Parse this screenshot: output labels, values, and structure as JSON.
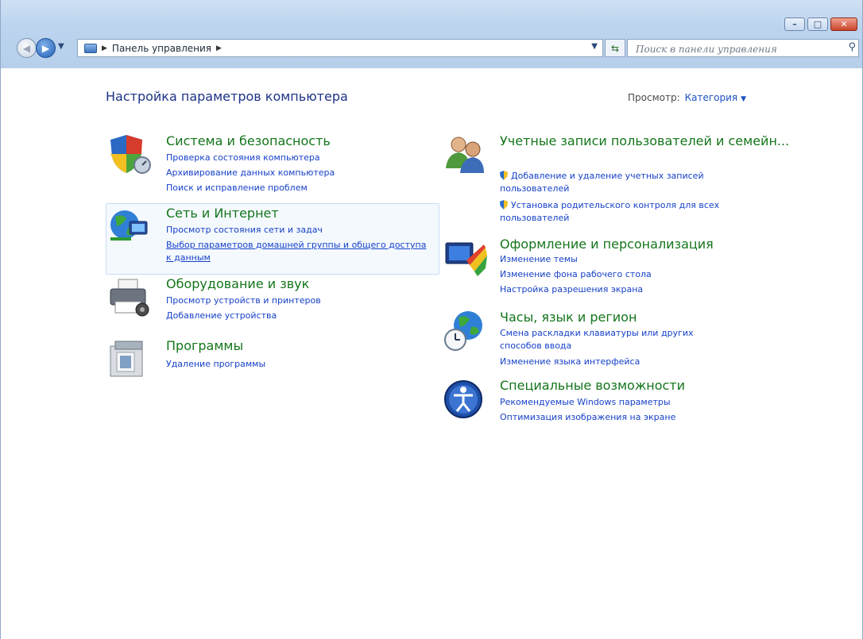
{
  "window": {
    "caption_buttons": {
      "minimize": "–",
      "maximize": "□",
      "close": "✕"
    }
  },
  "navbar": {
    "address_path": [
      "Панель управления"
    ],
    "search_placeholder": "Поиск в панели управления"
  },
  "page": {
    "title": "Настройка параметров компьютера",
    "view_label": "Просмотр:",
    "view_value": "Категория"
  },
  "categories": [
    {
      "title": "Система и безопасность",
      "icon": "shield-icon",
      "links": [
        "Проверка состояния компьютера",
        "Архивирование данных компьютера",
        "Поиск и исправление проблем"
      ]
    },
    {
      "title": "Сеть и Интернет",
      "icon": "network-globe-icon",
      "links": [
        "Просмотр состояния сети и задач",
        "Выбор параметров домашней группы и общего доступа к данным"
      ]
    },
    {
      "title": "Оборудование и звук",
      "icon": "printer-icon",
      "links": [
        "Просмотр устройств и принтеров",
        "Добавление устройства"
      ]
    },
    {
      "title": "Программы",
      "icon": "programs-icon",
      "links": [
        "Удаление программы"
      ]
    },
    {
      "title": "Учетные записи пользователей и семейн...",
      "icon": "users-icon",
      "links": [
        "Добавление и удаление учетных записей пользователей",
        "Установка родительского контроля для всех пользователей"
      ]
    },
    {
      "title": "Оформление и персонализация",
      "icon": "personalization-icon",
      "links": [
        "Изменение темы",
        "Изменение фона рабочего стола",
        "Настройка разрешения экрана"
      ]
    },
    {
      "title": "Часы, язык и регион",
      "icon": "clock-globe-icon",
      "links": [
        "Смена раскладки клавиатуры или других способов ввода",
        "Изменение языка интерфейса"
      ]
    },
    {
      "title": "Специальные возможности",
      "icon": "accessibility-icon",
      "links": [
        "Рекомендуемые Windows параметры",
        "Оптимизация изображения на экране"
      ]
    }
  ]
}
